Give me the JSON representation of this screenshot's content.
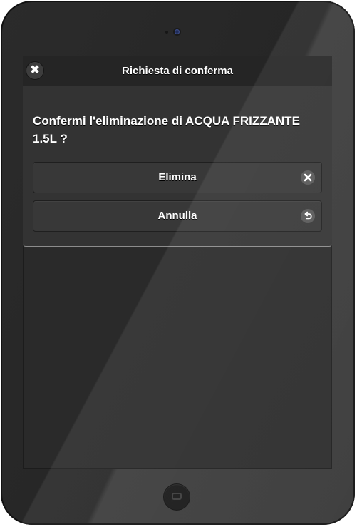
{
  "dialog": {
    "title": "Richiesta di conferma",
    "close_icon": "close-icon",
    "message": "Confermi l'eliminazione di ACQUA FRIZZANTE 1.5L ?",
    "buttons": [
      {
        "label": "Elimina",
        "icon": "delete-icon"
      },
      {
        "label": "Annulla",
        "icon": "undo-icon"
      }
    ]
  },
  "colors": {
    "bezel": "#2b2b2b",
    "screen": "#2a2a2a",
    "dialog": "#333333",
    "header": "#252525",
    "button": "#383838",
    "text": "#ffffff"
  }
}
